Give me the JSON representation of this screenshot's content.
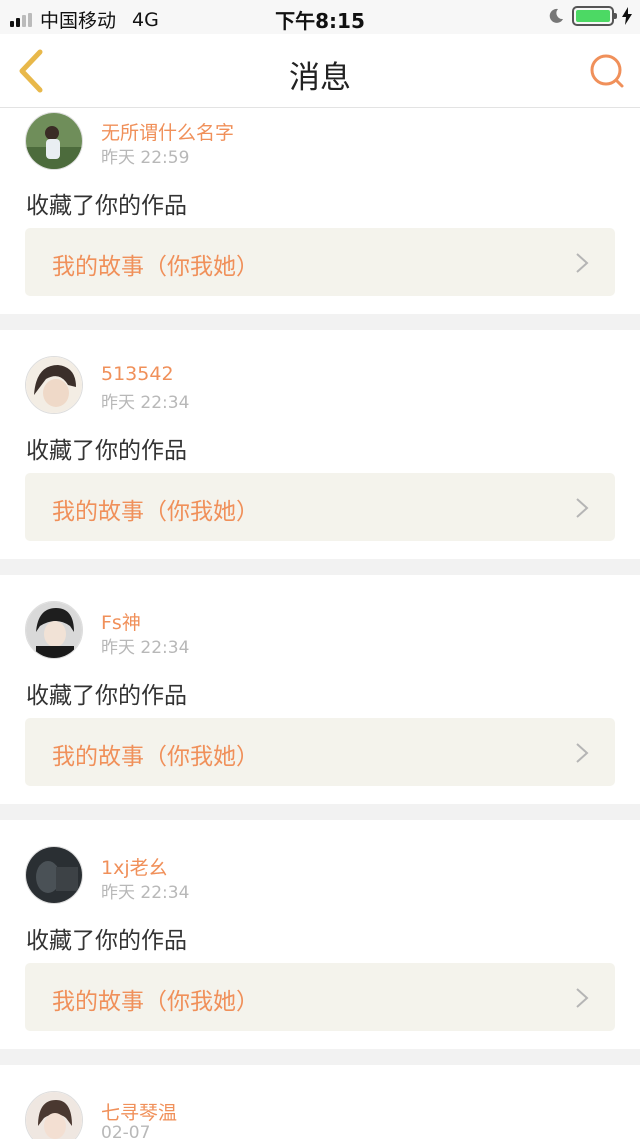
{
  "status_bar": {
    "carrier": "中国移动",
    "network": "4G",
    "time": "下午8:15",
    "icons": [
      "signal-icon",
      "moon-icon",
      "battery-icon",
      "charging-icon"
    ]
  },
  "nav": {
    "title": "消息",
    "back_icon": "chevron-left-icon",
    "search_icon": "search-icon",
    "accent_color": "#f0905a",
    "back_color": "#e8b84a"
  },
  "messages": [
    {
      "username": "无所谓什么名字",
      "time": "昨天 22:59",
      "action": "收藏了你的作品",
      "work": "我的故事（你我她）"
    },
    {
      "username": "513542",
      "time": "昨天 22:34",
      "action": "收藏了你的作品",
      "work": "我的故事（你我她）"
    },
    {
      "username": "Fs神",
      "time": "昨天 22:34",
      "action": "收藏了你的作品",
      "work": "我的故事（你我她）"
    },
    {
      "username": "1xj老幺",
      "time": "昨天 22:34",
      "action": "收藏了你的作品",
      "work": "我的故事（你我她）"
    },
    {
      "username": "七寻琴温",
      "time": "02-07"
    }
  ]
}
